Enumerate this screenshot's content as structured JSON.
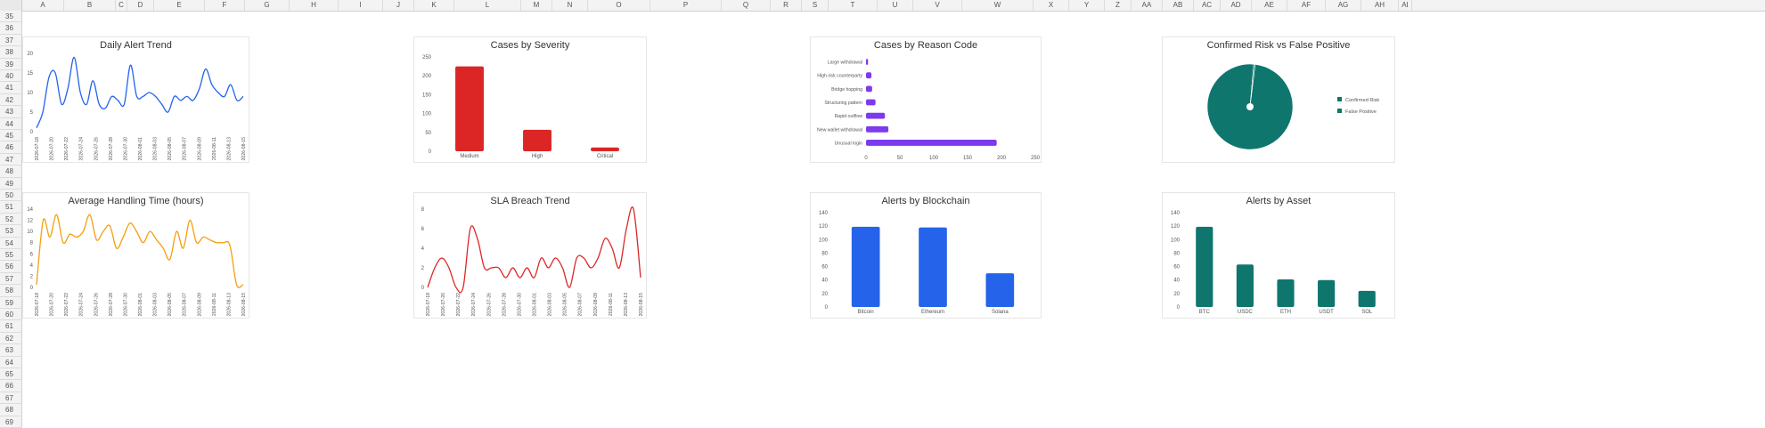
{
  "sheet": {
    "columns": [
      "A",
      "B",
      "C",
      "D",
      "E",
      "F",
      "G",
      "H",
      "I",
      "J",
      "K",
      "L",
      "M",
      "N",
      "O",
      "P",
      "Q",
      "R",
      "S",
      "T",
      "U",
      "V",
      "W",
      "X",
      "Y",
      "Z",
      "AA",
      "AB",
      "AC",
      "AD",
      "AE",
      "AF",
      "AG",
      "AH",
      "AI"
    ],
    "rows": [
      "35",
      "36",
      "37",
      "38",
      "39",
      "40",
      "41",
      "42",
      "43",
      "44",
      "45",
      "46",
      "47",
      "48",
      "49",
      "50",
      "51",
      "52",
      "53",
      "54",
      "55",
      "56",
      "57",
      "58",
      "59",
      "60",
      "61",
      "62",
      "63",
      "64",
      "65",
      "66",
      "67",
      "68",
      "69"
    ]
  },
  "colors": {
    "blue": "#2563EB",
    "orange": "#F59E0B",
    "red": "#DC2626",
    "purple": "#7C3AED",
    "teal": "#0F766E"
  },
  "dates": [
    "2026-07-18",
    "2026-07-20",
    "2026-07-22",
    "2026-07-24",
    "2026-07-26",
    "2026-07-28",
    "2026-07-30",
    "2026-08-01",
    "2026-08-03",
    "2026-08-05",
    "2026-08-07",
    "2026-08-09",
    "2026-08-11",
    "2026-08-13",
    "2026-08-15"
  ],
  "chart_data": [
    {
      "id": "daily_alert_trend",
      "type": "line",
      "title": "Daily Alert Trend",
      "xlabel": "",
      "ylabel": "",
      "ylim": [
        0,
        20
      ],
      "yticks": [
        0,
        5,
        10,
        15,
        20
      ],
      "x": [
        "2026-07-18",
        "2026-07-19",
        "2026-07-20",
        "2026-07-21",
        "2026-07-22",
        "2026-07-23",
        "2026-07-24",
        "2026-07-25",
        "2026-07-26",
        "2026-07-27",
        "2026-07-28",
        "2026-07-29",
        "2026-07-30",
        "2026-07-31",
        "2026-08-01",
        "2026-08-02",
        "2026-08-03",
        "2026-08-04",
        "2026-08-05",
        "2026-08-06",
        "2026-08-07",
        "2026-08-08",
        "2026-08-09",
        "2026-08-10",
        "2026-08-11",
        "2026-08-12",
        "2026-08-13",
        "2026-08-14",
        "2026-08-15",
        "2026-08-16"
      ],
      "series": [
        {
          "values": [
            1,
            5,
            14,
            15,
            7,
            11,
            19,
            10,
            7,
            13,
            7,
            6,
            9,
            8,
            7,
            17,
            9,
            9,
            10,
            9,
            7,
            5,
            9,
            8,
            9,
            8,
            11,
            16,
            12,
            10,
            9,
            12,
            8,
            9
          ],
          "color": "#2563EB"
        }
      ],
      "grid": false,
      "legend": "none"
    },
    {
      "id": "cases_by_severity",
      "type": "bar",
      "title": "Cases by Severity",
      "categories": [
        "Medium",
        "High",
        "Critical"
      ],
      "values": [
        225,
        57,
        10
      ],
      "ylim": [
        0,
        250
      ],
      "yticks": [
        0,
        50,
        100,
        150,
        200,
        250
      ],
      "color": "#DC2626",
      "grid": false,
      "legend": "none"
    },
    {
      "id": "cases_by_reason_code",
      "type": "bar",
      "orientation": "horizontal",
      "title": "Cases by Reason Code",
      "categories": [
        "Large withdrawal",
        "High-risk counterparty",
        "Bridge hopping",
        "Structuring pattern",
        "Rapid outflow",
        "New wallet withdrawal",
        "Unusual login"
      ],
      "values": [
        3,
        8,
        9,
        14,
        28,
        33,
        193
      ],
      "xlim": [
        0,
        250
      ],
      "xticks": [
        0,
        50,
        100,
        150,
        200,
        250
      ],
      "color": "#7C3AED",
      "grid": false,
      "legend": "none"
    },
    {
      "id": "confirmed_risk_vs_false_positive",
      "type": "pie",
      "title": "Confirmed Risk vs False Positive",
      "categories": [
        "Confirmed Risk",
        "False Positive"
      ],
      "values": [
        99.5,
        0.5
      ],
      "colors": [
        "#0F766E",
        "#0F766E"
      ],
      "legend": "right"
    },
    {
      "id": "average_handling_time",
      "type": "line",
      "title": "Average Handling Time (hours)",
      "ylim": [
        0,
        14
      ],
      "yticks": [
        0,
        2,
        4,
        6,
        8,
        10,
        12,
        14
      ],
      "series": [
        {
          "values": [
            0.5,
            12,
            9,
            13,
            8,
            9.5,
            9,
            10,
            13,
            8.5,
            10,
            11,
            7,
            9,
            11.5,
            10,
            8,
            10,
            8.5,
            7,
            5,
            10,
            7,
            12,
            8,
            9,
            8.5,
            8,
            8,
            7.5,
            0.5,
            0.5
          ],
          "color": "#F59E0B"
        }
      ],
      "grid": false,
      "legend": "none"
    },
    {
      "id": "sla_breach_trend",
      "type": "line",
      "title": "SLA Breach Trend",
      "ylim": [
        0,
        8
      ],
      "yticks": [
        0,
        2,
        4,
        6,
        8
      ],
      "series": [
        {
          "values": [
            0,
            2,
            3,
            2,
            0,
            0,
            6,
            5,
            2,
            2,
            2,
            1,
            2,
            1,
            2,
            1,
            3,
            2,
            3,
            2,
            0,
            3,
            3,
            2,
            3,
            5,
            4,
            2,
            6,
            8,
            1
          ],
          "color": "#DC2626"
        }
      ],
      "grid": false,
      "legend": "none"
    },
    {
      "id": "alerts_by_blockchain",
      "type": "bar",
      "title": "Alerts by Blockchain",
      "categories": [
        "Bitcoin",
        "Ethereum",
        "Solana"
      ],
      "values": [
        119,
        118,
        50
      ],
      "ylim": [
        0,
        140
      ],
      "yticks": [
        0,
        20,
        40,
        60,
        80,
        100,
        120,
        140
      ],
      "color": "#2563EB",
      "grid": false,
      "legend": "none"
    },
    {
      "id": "alerts_by_asset",
      "type": "bar",
      "title": "Alerts by Asset",
      "categories": [
        "BTC",
        "USDC",
        "ETH",
        "USDT",
        "SOL"
      ],
      "values": [
        119,
        63,
        41,
        40,
        24
      ],
      "ylim": [
        0,
        140
      ],
      "yticks": [
        0,
        20,
        40,
        60,
        80,
        100,
        120,
        140
      ],
      "color": "#0F766E",
      "grid": false,
      "legend": "none"
    }
  ]
}
